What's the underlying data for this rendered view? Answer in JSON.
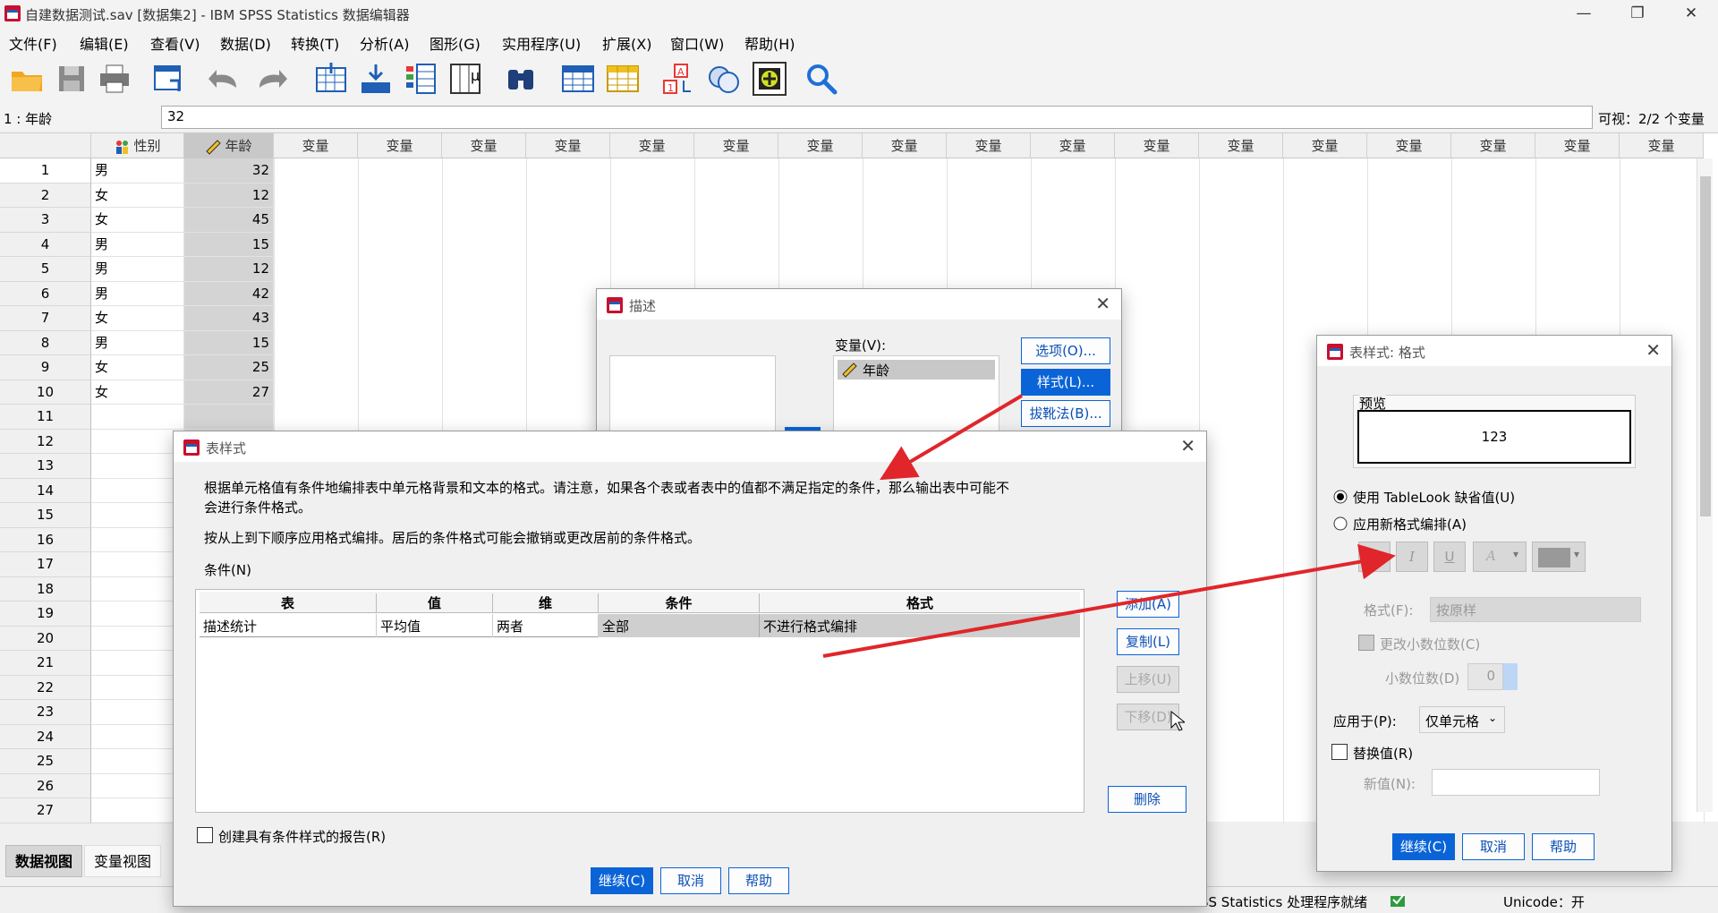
{
  "window": {
    "title": "自建数据测试.sav [数据集2] - IBM SPSS Statistics 数据编辑器",
    "minimize": "—",
    "restore": "❐",
    "close": "✕"
  },
  "menu": [
    "文件(F)",
    "编辑(E)",
    "查看(V)",
    "数据(D)",
    "转换(T)",
    "分析(A)",
    "图形(G)",
    "实用程序(U)",
    "扩展(X)",
    "窗口(W)",
    "帮助(H)"
  ],
  "editbar": {
    "cell_ref": "1 : 年龄",
    "cell_value": "32",
    "visible": "可视：2/2 个变量"
  },
  "grid": {
    "columns": [
      "性别",
      "年龄",
      "变量",
      "变量",
      "变量",
      "变量",
      "变量",
      "变量",
      "变量",
      "变量",
      "变量",
      "变量",
      "变量",
      "变量",
      "变量",
      "变量",
      "变量",
      "变量",
      "变量"
    ],
    "rows": [
      {
        "n": "1",
        "sex": "男",
        "age": "32"
      },
      {
        "n": "2",
        "sex": "女",
        "age": "12"
      },
      {
        "n": "3",
        "sex": "女",
        "age": "45"
      },
      {
        "n": "4",
        "sex": "男",
        "age": "15"
      },
      {
        "n": "5",
        "sex": "男",
        "age": "12"
      },
      {
        "n": "6",
        "sex": "男",
        "age": "42"
      },
      {
        "n": "7",
        "sex": "女",
        "age": "43"
      },
      {
        "n": "8",
        "sex": "男",
        "age": "15"
      },
      {
        "n": "9",
        "sex": "女",
        "age": "25"
      },
      {
        "n": "10",
        "sex": "女",
        "age": "27"
      },
      {
        "n": "11",
        "sex": "",
        "age": ""
      },
      {
        "n": "12",
        "sex": "",
        "age": ""
      },
      {
        "n": "13",
        "sex": "",
        "age": ""
      },
      {
        "n": "14",
        "sex": "",
        "age": ""
      },
      {
        "n": "15",
        "sex": "",
        "age": ""
      },
      {
        "n": "16",
        "sex": "",
        "age": ""
      },
      {
        "n": "17",
        "sex": "",
        "age": ""
      },
      {
        "n": "18",
        "sex": "",
        "age": ""
      },
      {
        "n": "19",
        "sex": "",
        "age": ""
      },
      {
        "n": "20",
        "sex": "",
        "age": ""
      },
      {
        "n": "21",
        "sex": "",
        "age": ""
      },
      {
        "n": "22",
        "sex": "",
        "age": ""
      },
      {
        "n": "23",
        "sex": "",
        "age": ""
      },
      {
        "n": "24",
        "sex": "",
        "age": ""
      },
      {
        "n": "25",
        "sex": "",
        "age": ""
      },
      {
        "n": "26",
        "sex": "",
        "age": ""
      },
      {
        "n": "27",
        "sex": "",
        "age": ""
      }
    ]
  },
  "tabs": {
    "data_view": "数据视图",
    "variable_view": "变量视图"
  },
  "status": {
    "processor": "IBM SPSS Statistics 处理程序就绪",
    "unicode": "Unicode：开"
  },
  "desc_dialog": {
    "title": "描述",
    "variables_label": "变量(V):",
    "variable_item": "年龄",
    "options_btn": "选项(O)...",
    "style_btn": "样式(L)...",
    "bootstrap_btn": "拔靴法(B)..."
  },
  "style_dialog": {
    "title": "表样式",
    "desc1": "根据单元格值有条件地编排表中单元格背景和文本的格式。请注意，如果各个表或者表中的值都不满足指定的条件，那么输出表中可能不",
    "desc1b": "会进行条件格式。",
    "desc2": "按从上到下顺序应用格式编排。居后的条件格式可能会撤销或更改居前的条件格式。",
    "conditions_label": "条件(N)",
    "table_headers": [
      "表",
      "值",
      "维",
      "条件",
      "格式"
    ],
    "table_row": [
      "描述统计",
      "平均值",
      "两者",
      "全部",
      "不进行格式编排"
    ],
    "add_btn": "添加(A)",
    "copy_btn": "复制(L)",
    "up_btn": "上移(U)",
    "down_btn": "下移(D)",
    "delete_btn": "删除",
    "report_checkbox": "创建具有条件样式的报告(R)",
    "continue_btn": "继续(C)",
    "cancel_btn": "取消",
    "help_btn": "帮助"
  },
  "format_dialog": {
    "title": "表样式: 格式",
    "preview_label": "预览",
    "preview_value": "123",
    "radio_default": "使用 TableLook 缺省值(U)",
    "radio_new": "应用新格式编排(A)",
    "bold": "B",
    "italic": "I",
    "underline": "U",
    "font_color": "A",
    "format_label": "格式(F):",
    "format_value": "按原样",
    "decimals_checkbox": "更改小数位数(C)",
    "decimals_label": "小数位数(D)",
    "decimals_value": "0",
    "apply_label": "应用于(P):",
    "apply_value": "仅单元格",
    "replace_checkbox": "替换值(R)",
    "new_value_label": "新值(N):",
    "continue_btn": "继续(C)",
    "cancel_btn": "取消",
    "help_btn": "帮助"
  },
  "colors": {
    "accent": "#0a64d8",
    "arrow": "#e0262b",
    "selected_column": "#d4d4d4"
  }
}
